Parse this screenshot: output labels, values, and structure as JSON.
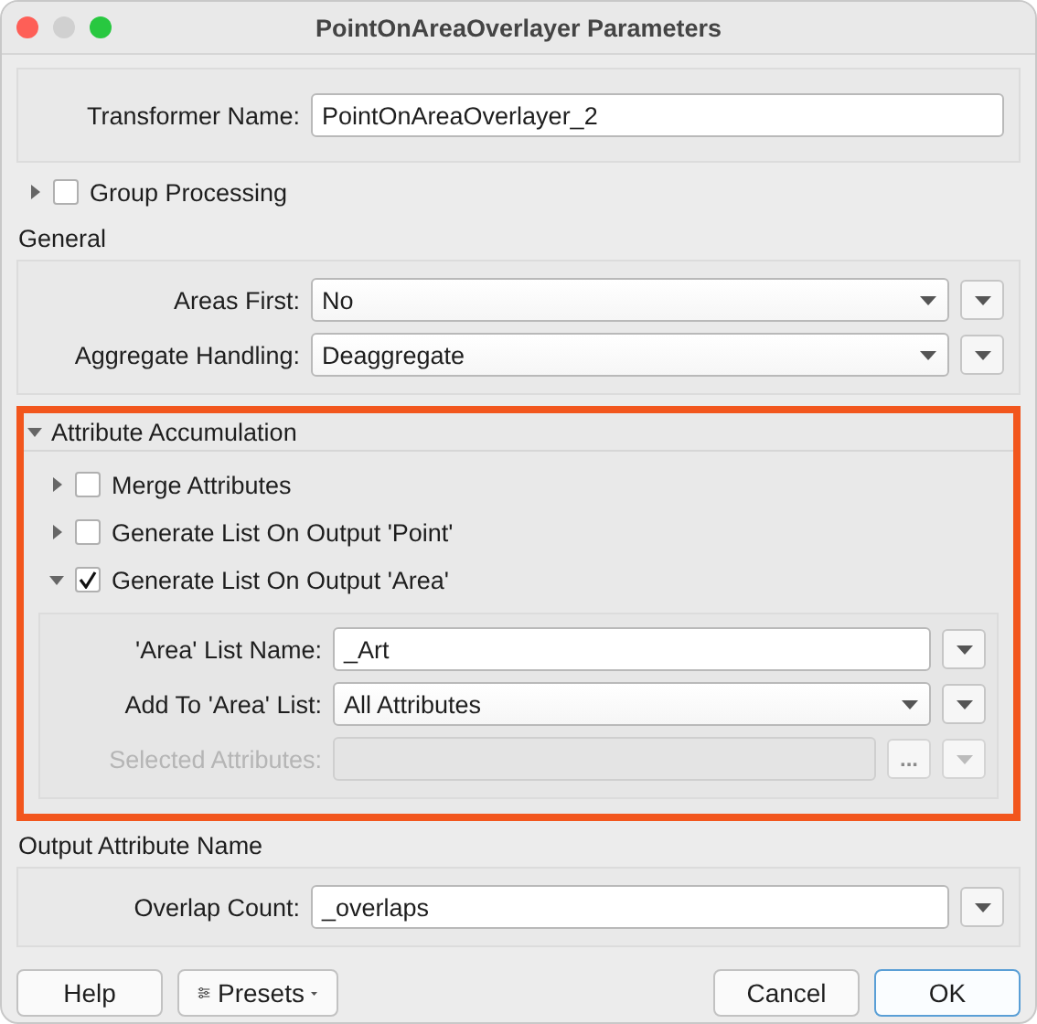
{
  "window": {
    "title": "PointOnAreaOverlayer Parameters"
  },
  "transformer": {
    "label": "Transformer Name:",
    "value": "PointOnAreaOverlayer_2"
  },
  "group_processing": {
    "label": "Group Processing",
    "checked": false,
    "expanded": false
  },
  "sections": [
    {
      "title": "General",
      "kind": "plain",
      "highlighted": false,
      "fields": [
        {
          "label": "Areas First:",
          "value": "No",
          "kind": "select",
          "disabled": false
        },
        {
          "label": "Aggregate Handling:",
          "value": "Deaggregate",
          "kind": "select",
          "disabled": false
        }
      ]
    },
    {
      "title": "Attribute Accumulation",
      "kind": "collapsible",
      "expanded": true,
      "highlighted": true,
      "options": [
        {
          "label": "Merge Attributes",
          "checked": false,
          "expanded": false
        },
        {
          "label": "Generate List On Output 'Point'",
          "checked": false,
          "expanded": false
        },
        {
          "label": "Generate List On Output 'Area'",
          "checked": true,
          "expanded": true,
          "fields": [
            {
              "label": "'Area' List Name:",
              "value": "_Art",
              "kind": "text",
              "disabled": false
            },
            {
              "label": "Add To 'Area' List:",
              "value": "All Attributes",
              "kind": "select",
              "disabled": false
            },
            {
              "label": "Selected Attributes:",
              "kind": "text",
              "disabled": true,
              "extra": "..."
            }
          ]
        }
      ]
    },
    {
      "title": "Output Attribute Name",
      "kind": "plain",
      "highlighted": false,
      "fields": [
        {
          "label": "Overlap Count:",
          "value": "_overlaps",
          "kind": "text",
          "disabled": false
        }
      ]
    }
  ],
  "buttons": [
    {
      "label": "Help",
      "kind": "plain",
      "default": false
    },
    {
      "label": "Presets",
      "kind": "menu",
      "default": false
    },
    {
      "label": "Cancel",
      "kind": "plain",
      "default": false
    },
    {
      "label": "OK",
      "kind": "plain",
      "default": true
    }
  ]
}
